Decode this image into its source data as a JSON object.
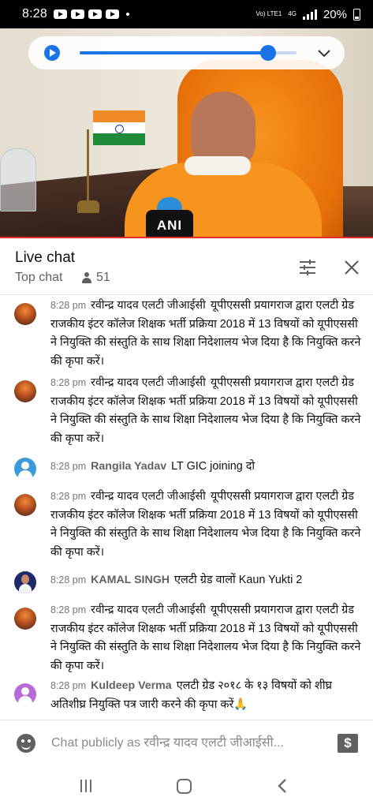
{
  "status_bar": {
    "time": "8:28",
    "network": "4G",
    "volte": "Vo) LTE1",
    "battery": "20%"
  },
  "player": {
    "progress_fraction": 0.87
  },
  "video": {
    "mic_label": "ANI"
  },
  "chat_header": {
    "title": "Live chat",
    "mode": "Top chat",
    "viewer_count": "51"
  },
  "messages": [
    {
      "time": "8:28 pm",
      "author": "रवीन्द्र यादव एलटी जीआईसी",
      "text": "यूपीएससी प्रयागराज द्वारा एलटी ग्रेड राजकीय इंटर कॉलेज शिक्षक भर्ती प्रक्रिया 2018 में 13 विषयों को यूपीएससी ने नियुक्ति की संस्तुति के साथ शिक्षा निदेशालय भेज दिया है कि नियुक्ति करने की कृपा करें।"
    },
    {
      "time": "8:28 pm",
      "author": "रवीन्द्र यादव एलटी जीआईसी",
      "text": "यूपीएससी प्रयागराज द्वारा एलटी ग्रेड राजकीय इंटर कॉलेज शिक्षक भर्ती प्रक्रिया 2018 में 13 विषयों को यूपीएससी ने नियुक्ति की संस्तुति के साथ शिक्षा निदेशालय भेज दिया है कि नियुक्ति करने की कृपा करें।"
    },
    {
      "time": "8:28 pm",
      "author": "Rangila Yadav",
      "text": "LT GIC joining दो"
    },
    {
      "time": "8:28 pm",
      "author": "रवीन्द्र यादव एलटी जीआईसी",
      "text": "यूपीएससी प्रयागराज द्वारा एलटी ग्रेड राजकीय इंटर कॉलेज शिक्षक भर्ती प्रक्रिया 2018 में 13 विषयों को यूपीएससी ने नियुक्ति की संस्तुति के साथ शिक्षा निदेशालय भेज दिया है कि नियुक्ति करने की कृपा करें।"
    },
    {
      "time": "8:28 pm",
      "author": "KAMAL SINGH",
      "text": "एलटी ग्रेड वालों Kaun Yukti 2"
    },
    {
      "time": "8:28 pm",
      "author": "रवीन्द्र यादव एलटी जीआईसी",
      "text": "यूपीएससी प्रयागराज द्वारा एलटी ग्रेड राजकीय इंटर कॉलेज शिक्षक भर्ती प्रक्रिया 2018 में 13 विषयों को यूपीएससी ने नियुक्ति की संस्तुति के साथ शिक्षा निदेशालय भेज दिया है कि नियुक्ति करने की कृपा करें।"
    },
    {
      "time": "8:28 pm",
      "author": "Kuldeep Verma",
      "text": "एलटी ग्रेड २०१८ के १३ विषयों को शीघ्र अतिशीघ्र नियुक्ति पत्र जारी करने की कृपा करें🙏"
    }
  ],
  "input": {
    "placeholder": "Chat publicly as रवीन्द्र यादव एलटी जीआईसी..."
  },
  "icons": {
    "super_chat": "$"
  },
  "colors": {
    "accent": "#1a73e8",
    "progress_red": "#e52d27",
    "saffron": "#f7941d"
  }
}
